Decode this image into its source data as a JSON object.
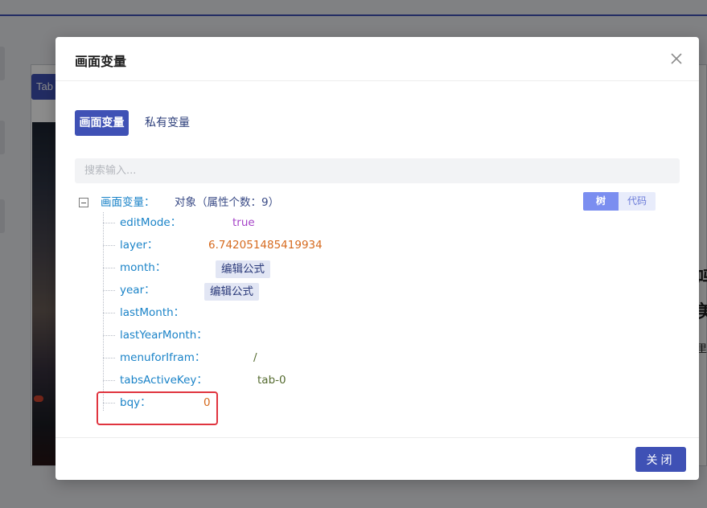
{
  "background": {
    "tab_label": "Tab",
    "right_text_1": "吗",
    "right_text_2": "美",
    "right_text_3": "里"
  },
  "modal": {
    "title": "画面变量",
    "close_icon": "close-icon",
    "tabs": [
      {
        "label": "画面变量",
        "active": true
      },
      {
        "label": "私有变量",
        "active": false
      }
    ],
    "search": {
      "placeholder": "搜索输入...",
      "value": ""
    },
    "view_toggle": {
      "tree_label": "树",
      "code_label": "代码",
      "selected": "树"
    },
    "tree": {
      "root_key": "画面变量：",
      "root_desc": "对象（属性个数：9）",
      "nodes": [
        {
          "key": "editMode：",
          "value": "true",
          "type": "boolean"
        },
        {
          "key": "layer：",
          "value": "6.742051485419934",
          "type": "number"
        },
        {
          "key": "month：",
          "value": "编辑公式",
          "type": "formula"
        },
        {
          "key": "year：",
          "value": "编辑公式",
          "type": "formula"
        },
        {
          "key": "lastMonth：",
          "value": "",
          "type": "empty"
        },
        {
          "key": "lastYearMonth：",
          "value": "",
          "type": "empty"
        },
        {
          "key": "menuforIfram：",
          "value": "/",
          "type": "string"
        },
        {
          "key": "tabsActiveKey：",
          "value": "tab-0",
          "type": "string"
        },
        {
          "key": "bqy：",
          "value": "0",
          "type": "number"
        }
      ]
    },
    "footer": {
      "close_label": "关闭"
    }
  },
  "colors": {
    "primary": "#3f51b5",
    "key_blue": "#1a83c8",
    "boolean_purple": "#a543c7",
    "number_orange": "#d66a1e",
    "string_olive": "#556b2f",
    "highlight_red": "#e0343f"
  }
}
